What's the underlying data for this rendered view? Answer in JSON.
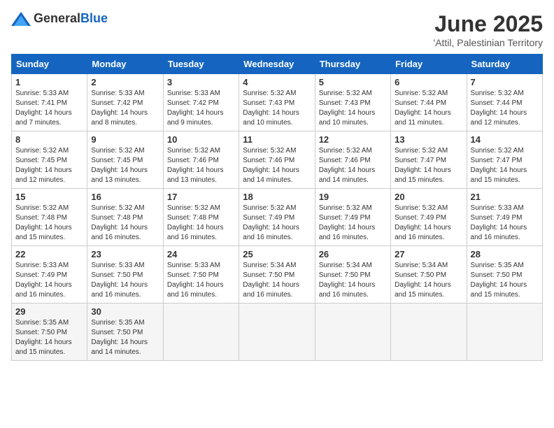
{
  "header": {
    "logo_general": "General",
    "logo_blue": "Blue",
    "title": "June 2025",
    "subtitle": "'Attil, Palestinian Territory"
  },
  "days_of_week": [
    "Sunday",
    "Monday",
    "Tuesday",
    "Wednesday",
    "Thursday",
    "Friday",
    "Saturday"
  ],
  "weeks": [
    [
      {
        "day": "1",
        "sunrise": "5:33 AM",
        "sunset": "7:41 PM",
        "daylight": "14 hours and 7 minutes."
      },
      {
        "day": "2",
        "sunrise": "5:33 AM",
        "sunset": "7:42 PM",
        "daylight": "14 hours and 8 minutes."
      },
      {
        "day": "3",
        "sunrise": "5:33 AM",
        "sunset": "7:42 PM",
        "daylight": "14 hours and 9 minutes."
      },
      {
        "day": "4",
        "sunrise": "5:32 AM",
        "sunset": "7:43 PM",
        "daylight": "14 hours and 10 minutes."
      },
      {
        "day": "5",
        "sunrise": "5:32 AM",
        "sunset": "7:43 PM",
        "daylight": "14 hours and 10 minutes."
      },
      {
        "day": "6",
        "sunrise": "5:32 AM",
        "sunset": "7:44 PM",
        "daylight": "14 hours and 11 minutes."
      },
      {
        "day": "7",
        "sunrise": "5:32 AM",
        "sunset": "7:44 PM",
        "daylight": "14 hours and 12 minutes."
      }
    ],
    [
      {
        "day": "8",
        "sunrise": "5:32 AM",
        "sunset": "7:45 PM",
        "daylight": "14 hours and 12 minutes."
      },
      {
        "day": "9",
        "sunrise": "5:32 AM",
        "sunset": "7:45 PM",
        "daylight": "14 hours and 13 minutes."
      },
      {
        "day": "10",
        "sunrise": "5:32 AM",
        "sunset": "7:46 PM",
        "daylight": "14 hours and 13 minutes."
      },
      {
        "day": "11",
        "sunrise": "5:32 AM",
        "sunset": "7:46 PM",
        "daylight": "14 hours and 14 minutes."
      },
      {
        "day": "12",
        "sunrise": "5:32 AM",
        "sunset": "7:46 PM",
        "daylight": "14 hours and 14 minutes."
      },
      {
        "day": "13",
        "sunrise": "5:32 AM",
        "sunset": "7:47 PM",
        "daylight": "14 hours and 15 minutes."
      },
      {
        "day": "14",
        "sunrise": "5:32 AM",
        "sunset": "7:47 PM",
        "daylight": "14 hours and 15 minutes."
      }
    ],
    [
      {
        "day": "15",
        "sunrise": "5:32 AM",
        "sunset": "7:48 PM",
        "daylight": "14 hours and 15 minutes."
      },
      {
        "day": "16",
        "sunrise": "5:32 AM",
        "sunset": "7:48 PM",
        "daylight": "14 hours and 16 minutes."
      },
      {
        "day": "17",
        "sunrise": "5:32 AM",
        "sunset": "7:48 PM",
        "daylight": "14 hours and 16 minutes."
      },
      {
        "day": "18",
        "sunrise": "5:32 AM",
        "sunset": "7:49 PM",
        "daylight": "14 hours and 16 minutes."
      },
      {
        "day": "19",
        "sunrise": "5:32 AM",
        "sunset": "7:49 PM",
        "daylight": "14 hours and 16 minutes."
      },
      {
        "day": "20",
        "sunrise": "5:32 AM",
        "sunset": "7:49 PM",
        "daylight": "14 hours and 16 minutes."
      },
      {
        "day": "21",
        "sunrise": "5:33 AM",
        "sunset": "7:49 PM",
        "daylight": "14 hours and 16 minutes."
      }
    ],
    [
      {
        "day": "22",
        "sunrise": "5:33 AM",
        "sunset": "7:49 PM",
        "daylight": "14 hours and 16 minutes."
      },
      {
        "day": "23",
        "sunrise": "5:33 AM",
        "sunset": "7:50 PM",
        "daylight": "14 hours and 16 minutes."
      },
      {
        "day": "24",
        "sunrise": "5:33 AM",
        "sunset": "7:50 PM",
        "daylight": "14 hours and 16 minutes."
      },
      {
        "day": "25",
        "sunrise": "5:34 AM",
        "sunset": "7:50 PM",
        "daylight": "14 hours and 16 minutes."
      },
      {
        "day": "26",
        "sunrise": "5:34 AM",
        "sunset": "7:50 PM",
        "daylight": "14 hours and 16 minutes."
      },
      {
        "day": "27",
        "sunrise": "5:34 AM",
        "sunset": "7:50 PM",
        "daylight": "14 hours and 15 minutes."
      },
      {
        "day": "28",
        "sunrise": "5:35 AM",
        "sunset": "7:50 PM",
        "daylight": "14 hours and 15 minutes."
      }
    ],
    [
      {
        "day": "29",
        "sunrise": "5:35 AM",
        "sunset": "7:50 PM",
        "daylight": "14 hours and 15 minutes."
      },
      {
        "day": "30",
        "sunrise": "5:35 AM",
        "sunset": "7:50 PM",
        "daylight": "14 hours and 14 minutes."
      },
      null,
      null,
      null,
      null,
      null
    ]
  ]
}
